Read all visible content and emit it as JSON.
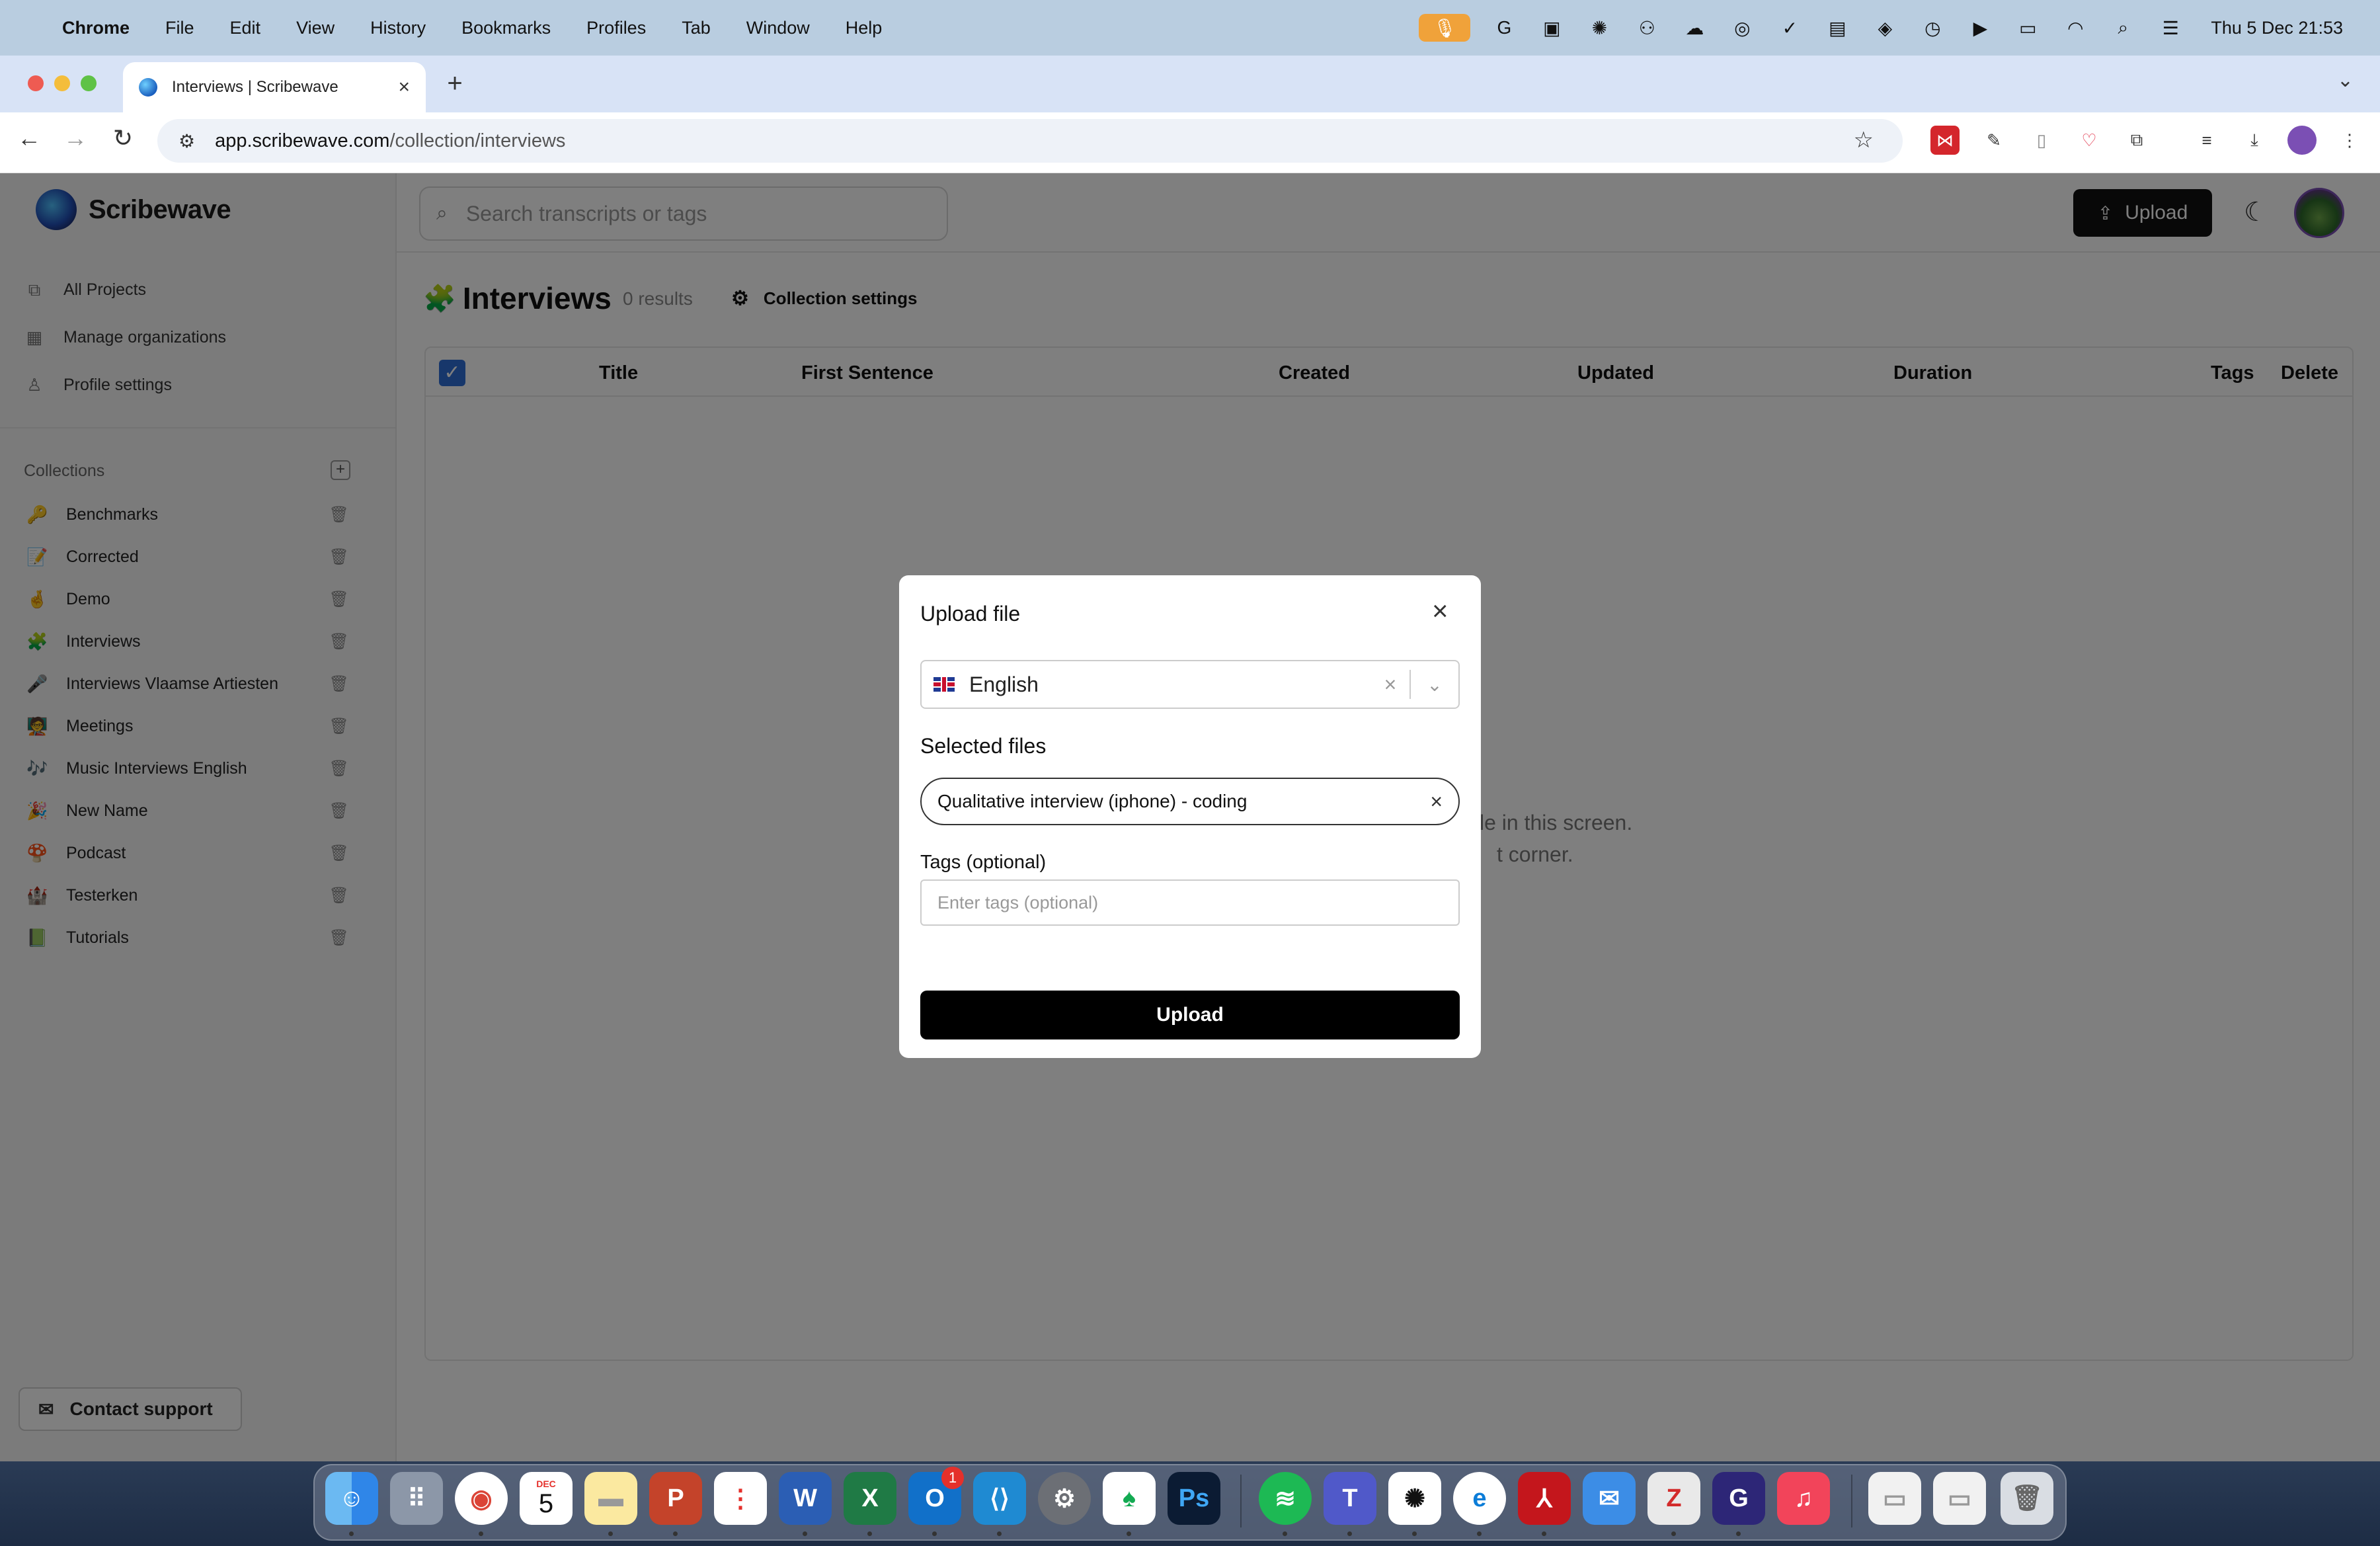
{
  "menubar": {
    "app": "Chrome",
    "items": [
      "File",
      "Edit",
      "View",
      "History",
      "Bookmarks",
      "Profiles",
      "Tab",
      "Window",
      "Help"
    ],
    "clock": "Thu 5 Dec  21:53"
  },
  "browser": {
    "tab_title": "Interviews | Scribewave",
    "url_domain": "app.scribewave.com",
    "url_path": "/collection/interviews"
  },
  "sidebar": {
    "brand": "Scribewave",
    "nav": [
      {
        "label": "All Projects",
        "icon": "documents-icon"
      },
      {
        "label": "Manage organizations",
        "icon": "building-icon"
      },
      {
        "label": "Profile settings",
        "icon": "person-icon"
      }
    ],
    "collections_header": "Collections",
    "collections": [
      {
        "emoji": "🔑",
        "label": "Benchmarks"
      },
      {
        "emoji": "📝",
        "label": "Corrected"
      },
      {
        "emoji": "🤞",
        "label": "Demo"
      },
      {
        "emoji": "🧩",
        "label": "Interviews"
      },
      {
        "emoji": "🎤",
        "label": "Interviews Vlaamse Artiesten"
      },
      {
        "emoji": "🧑‍🏫",
        "label": "Meetings"
      },
      {
        "emoji": "🎶",
        "label": "Music Interviews English"
      },
      {
        "emoji": "🎉",
        "label": "New Name"
      },
      {
        "emoji": "🍄",
        "label": "Podcast"
      },
      {
        "emoji": "🏰",
        "label": "Testerken"
      },
      {
        "emoji": "📗",
        "label": "Tutorials"
      }
    ],
    "support_label": "Contact support"
  },
  "header": {
    "search_placeholder": "Search transcripts or tags",
    "upload_label": "Upload"
  },
  "page": {
    "emoji": "🧩",
    "title": "Interviews",
    "results": "0 results",
    "collection_settings": "Collection settings",
    "columns": [
      "Title",
      "First Sentence",
      "Created",
      "Updated",
      "Duration",
      "Tags",
      "Delete"
    ],
    "empty_line1": "file in this screen.",
    "empty_line2": "t corner."
  },
  "modal": {
    "title": "Upload file",
    "language": "English",
    "selected_files_label": "Selected files",
    "file_name": "Qualitative interview (iphone) - coding",
    "tags_label": "Tags (optional)",
    "tags_placeholder": "Enter tags (optional)",
    "tags_value": "",
    "upload_label": "Upload"
  },
  "dock": {
    "calendar_month": "DEC",
    "calendar_day": "5",
    "outlook_badge": "1"
  },
  "colors": {
    "primary_button": "#111111",
    "checkbox_accent": "#2f6fd6",
    "menubar": "#b9cde0"
  }
}
